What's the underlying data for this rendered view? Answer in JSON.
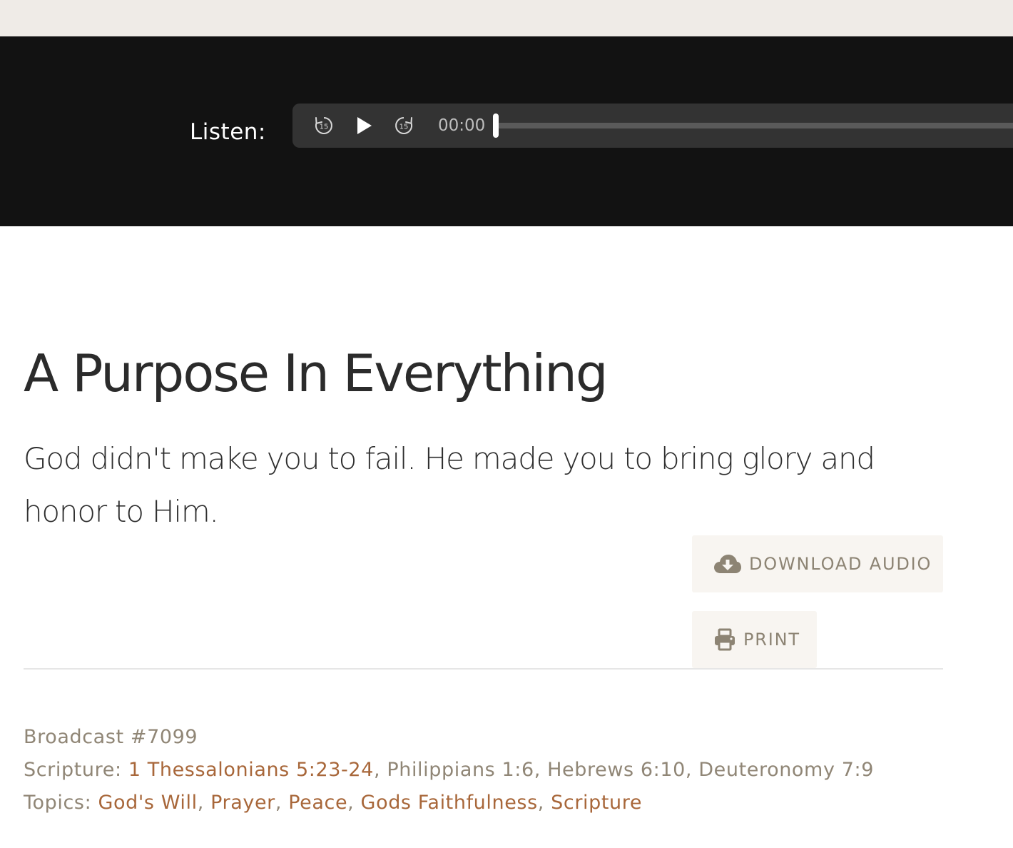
{
  "player": {
    "listen_label": "Listen:",
    "time": "00:00",
    "progress": 0,
    "controls": {
      "rewind_icon": "rewind-15-icon",
      "rewind_seconds": "15",
      "play_icon": "play-icon",
      "forward_icon": "forward-15-icon",
      "forward_seconds": "15"
    }
  },
  "article": {
    "title": "A Purpose In Everything",
    "subtitle": "God didn't make you to fail. He made you to bring glory and honor to Him."
  },
  "actions": {
    "download_label": "DOWNLOAD AUDIO",
    "download_icon": "cloud-download-icon",
    "print_label": "PRINT",
    "print_icon": "printer-icon"
  },
  "meta": {
    "broadcast": "Broadcast #7099",
    "scripture_label": "Scripture: ",
    "scripture": [
      {
        "text": "1 Thessalonians 5:23-24",
        "link": true
      },
      {
        "text": "Philippians 1:6",
        "link": false
      },
      {
        "text": "Hebrews 6:10",
        "link": false
      },
      {
        "text": "Deuteronomy 7:9",
        "link": false
      }
    ],
    "topics_label": "Topics: ",
    "topics": [
      "God's Will",
      "Prayer",
      "Peace",
      "Gods Faithfulness",
      "Scripture"
    ],
    "separator": ", "
  },
  "colors": {
    "link": "#a8673a",
    "muted": "#908676",
    "band": "#121212",
    "topbar": "#efebe7",
    "button_bg": "#f8f5f1"
  }
}
